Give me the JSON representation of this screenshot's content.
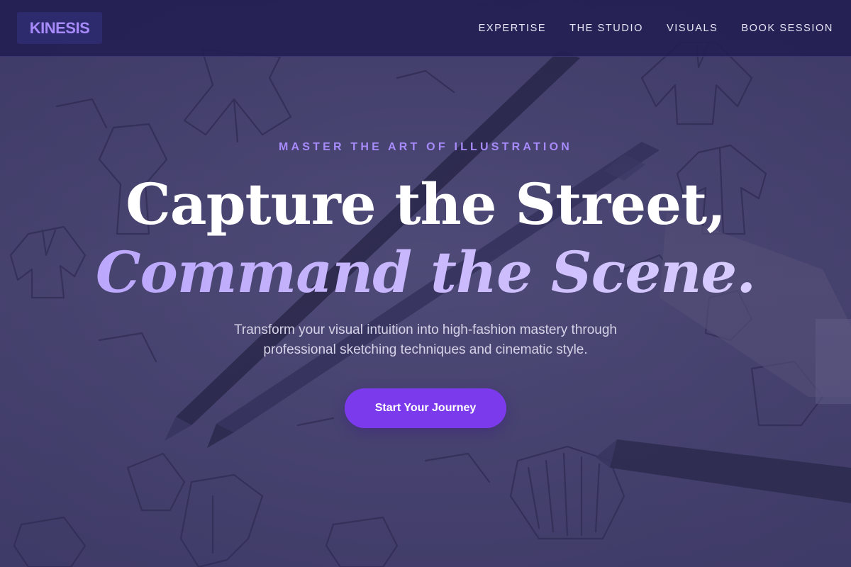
{
  "brand": {
    "logo_text": "KINESIS",
    "accent_color": "#a78bfa"
  },
  "nav": {
    "items": [
      {
        "label": "EXPERTISE"
      },
      {
        "label": "THE STUDIO"
      },
      {
        "label": "VISUALS"
      },
      {
        "label": "BOOK SESSION"
      }
    ]
  },
  "hero": {
    "eyebrow": "MASTER THE ART OF ILLUSTRATION",
    "headline_line1": "Capture the Street,",
    "headline_line2": "Command the Scene.",
    "subtitle_line1": "Transform your visual intuition into high-fashion mastery through",
    "subtitle_line2": "professional sketching techniques and cinematic style.",
    "cta_label": "Start Your Journey",
    "cta_color": "#7c3aed",
    "background_description_icon": "sketchbook-pencils-background"
  }
}
